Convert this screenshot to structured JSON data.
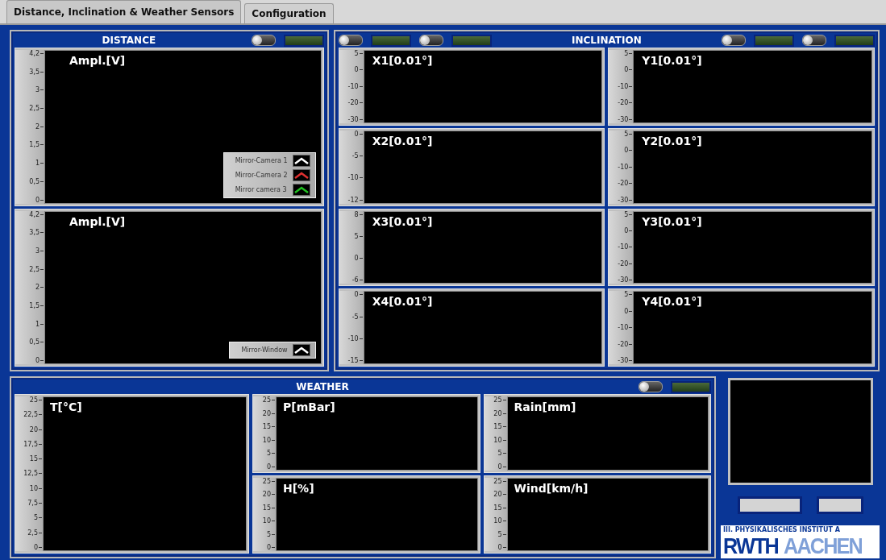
{
  "tabs": [
    {
      "label": "Distance, Inclination & Weather Sensors",
      "selected": true
    },
    {
      "label": "Configuration",
      "selected": false
    }
  ],
  "distance": {
    "title": "DISTANCE",
    "switches": [
      {
        "on": false
      }
    ],
    "graphs": [
      {
        "title": "Ampl.[V]",
        "yticks": [
          "4,2",
          "3,5",
          "3",
          "2,5",
          "2",
          "1,5",
          "1",
          "0,5",
          "0"
        ],
        "legend": [
          {
            "name": "Mirror-Camera 1",
            "color": "#ffffff"
          },
          {
            "name": "Mirror-Camera 2",
            "color": "#e03030"
          },
          {
            "name": "Mirror camera 3",
            "color": "#20c020"
          }
        ]
      },
      {
        "title": "Ampl.[V]",
        "yticks": [
          "4,2",
          "3,5",
          "3",
          "2,5",
          "2",
          "1,5",
          "1",
          "0,5",
          "0"
        ],
        "legend": [
          {
            "name": "Mirror-Window",
            "color": "#ffffff"
          }
        ]
      }
    ]
  },
  "inclination": {
    "title": "INCLINATION",
    "switches_left": [
      {
        "on": false
      },
      {
        "on": false
      }
    ],
    "switches_right": [
      {
        "on": false
      },
      {
        "on": false
      }
    ],
    "columns": [
      [
        {
          "title": "X1[0.01°]",
          "yticks": [
            "5",
            "0",
            "-10",
            "-20",
            "-30"
          ]
        },
        {
          "title": "X2[0.01°]",
          "yticks": [
            "0",
            "-5",
            "-10",
            "-12"
          ]
        },
        {
          "title": "X3[0.01°]",
          "yticks": [
            "8",
            "5",
            "0",
            "-6"
          ]
        },
        {
          "title": "X4[0.01°]",
          "yticks": [
            "0",
            "-5",
            "-10",
            "-15"
          ]
        }
      ],
      [
        {
          "title": "Y1[0.01°]",
          "yticks": [
            "5",
            "0",
            "-10",
            "-20",
            "-30"
          ]
        },
        {
          "title": "Y2[0.01°]",
          "yticks": [
            "5",
            "0",
            "-10",
            "-20",
            "-30"
          ]
        },
        {
          "title": "Y3[0.01°]",
          "yticks": [
            "5",
            "0",
            "-10",
            "-20",
            "-30"
          ]
        },
        {
          "title": "Y4[0.01°]",
          "yticks": [
            "5",
            "0",
            "-10",
            "-20",
            "-30"
          ]
        }
      ]
    ]
  },
  "weather": {
    "title": "WEATHER",
    "switches": [
      {
        "on": false
      }
    ],
    "main": {
      "title": "T[°C]",
      "yticks": [
        "25",
        "22,5",
        "20",
        "17,5",
        "15",
        "12,5",
        "10",
        "7,5",
        "5",
        "2,5",
        "0"
      ]
    },
    "columns": [
      [
        {
          "title": "P[mBar]",
          "yticks": [
            "25",
            "20",
            "15",
            "10",
            "5",
            "0"
          ]
        },
        {
          "title": "H[%]",
          "yticks": [
            "25",
            "20",
            "15",
            "10",
            "5",
            "0"
          ]
        }
      ],
      [
        {
          "title": "Rain[mm]",
          "yticks": [
            "25",
            "20",
            "15",
            "10",
            "5",
            "0"
          ]
        },
        {
          "title": "Wind[km/h]",
          "yticks": [
            "25",
            "20",
            "15",
            "10",
            "5",
            "0"
          ]
        }
      ]
    ]
  },
  "logo": {
    "subtitle": "III. PHYSIKALISCHES INSTITUT A",
    "word_1": "RWTH",
    "word_2": "AACHEN"
  }
}
